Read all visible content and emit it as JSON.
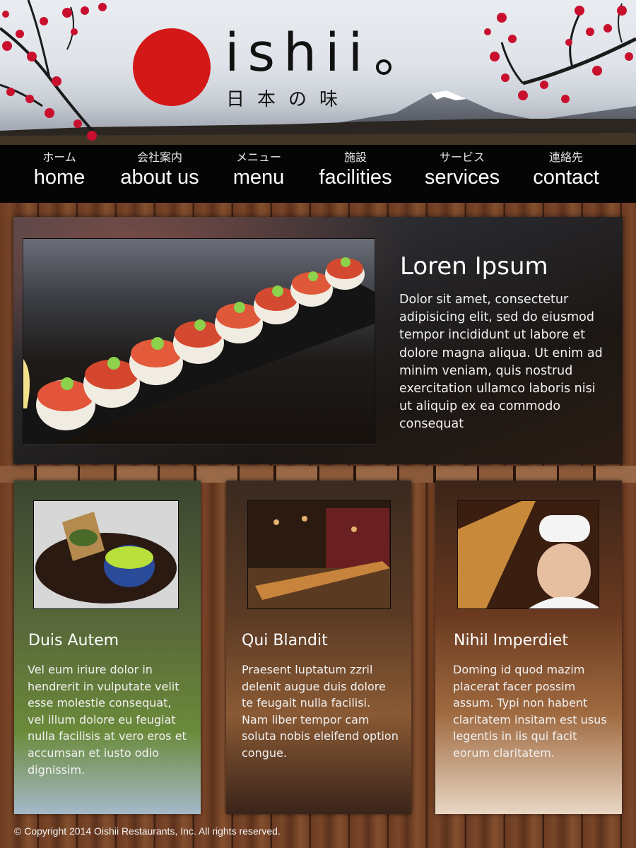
{
  "brand": {
    "name": "ishii",
    "tagline_jp": "日本の味"
  },
  "nav": {
    "items": [
      {
        "jp": "ホーム",
        "en": "home"
      },
      {
        "jp": "会社案内",
        "en": "about us"
      },
      {
        "jp": "メニュー",
        "en": "menu"
      },
      {
        "jp": "施設",
        "en": "facilities"
      },
      {
        "jp": "サービス",
        "en": "services"
      },
      {
        "jp": "連絡先",
        "en": "contact"
      }
    ]
  },
  "hero": {
    "title": "Loren Ipsum",
    "body": "Dolor sit amet, consectetur adipisicing elit, sed do eiusmod tempor incididunt ut labore et dolore magna aliqua. Ut enim ad minim veniam, quis nostrud exercitation ullamco laboris nisi ut aliquip ex ea commodo consequat"
  },
  "cards": [
    {
      "title": "Duis Autem",
      "body": "Vel eum iriure dolor in hendrerit in vulputate velit esse molestie consequat, vel illum dolore eu feugiat nulla facilisis at vero eros et accumsan et iusto odio dignissim."
    },
    {
      "title": "Qui Blandit",
      "body": "Praesent luptatum zzril delenit augue duis dolore te feugait nulla facilisi. Nam liber tempor cam soluta nobis eleifend option congue."
    },
    {
      "title": "Nihil Imperdiet",
      "body": "Doming id quod mazim placerat facer possim assum. Typi non habent claritatem insitam est usus legentis in iis qui facit eorum claritatem."
    }
  ],
  "footer": {
    "copyright": "© Copyright 2014 Oishii Restaurants, Inc. All rights reserved."
  },
  "colors": {
    "sun_red": "#d41717",
    "blossom_red": "#c8102e",
    "nav_bg": "#050505",
    "wood": "#6b3c23"
  }
}
